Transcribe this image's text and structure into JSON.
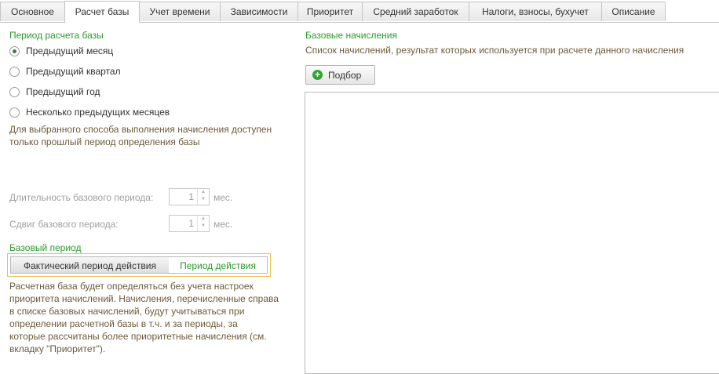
{
  "tabs": [
    {
      "label": "Основное"
    },
    {
      "label": "Расчет базы"
    },
    {
      "label": "Учет времени"
    },
    {
      "label": "Зависимости"
    },
    {
      "label": "Приоритет"
    },
    {
      "label": "Средний заработок"
    },
    {
      "label": "Налоги, взносы, бухучет"
    },
    {
      "label": "Описание"
    }
  ],
  "period": {
    "title": "Период расчета базы",
    "options": [
      {
        "label": "Предыдущий месяц",
        "selected": true
      },
      {
        "label": "Предыдущий квартал",
        "selected": false
      },
      {
        "label": "Предыдущий год",
        "selected": false
      },
      {
        "label": "Несколько предыдущих месяцев",
        "selected": false
      }
    ],
    "note_line1": "Для выбранного способа выполнения начисления доступен",
    "note_line2": "только прошлый период определения базы"
  },
  "duration": {
    "label": "Длительность базового периода:",
    "value": "1",
    "unit": "мес."
  },
  "shift": {
    "label": "Сдвиг базового периода:",
    "value": "1",
    "unit": "мес."
  },
  "base_period": {
    "title": "Базовый период",
    "option_actual": "Фактический период действия",
    "option_period": "Период действия",
    "active": "Фактический период действия",
    "note_lines": [
      "Расчетная база будет определяться без учета настроек",
      "приоритета начислений. Начисления, перечисленные справа",
      "в списке базовых начислений, будут учитываться при",
      "определении расчетной базы в т.ч. и за периоды, за",
      "которые рассчитаны более приоритетные начисления (см.",
      "вкладку \"Приоритет\")."
    ]
  },
  "base_charges": {
    "title": "Базовые начисления",
    "description": "Список начислений, результат которых используется при расчете данного начисления",
    "pick_button": "Подбор"
  },
  "colors": {
    "accent_green": "#2a9b2a",
    "highlight_border": "#e8c24a",
    "note_text": "#6b5a3a"
  }
}
